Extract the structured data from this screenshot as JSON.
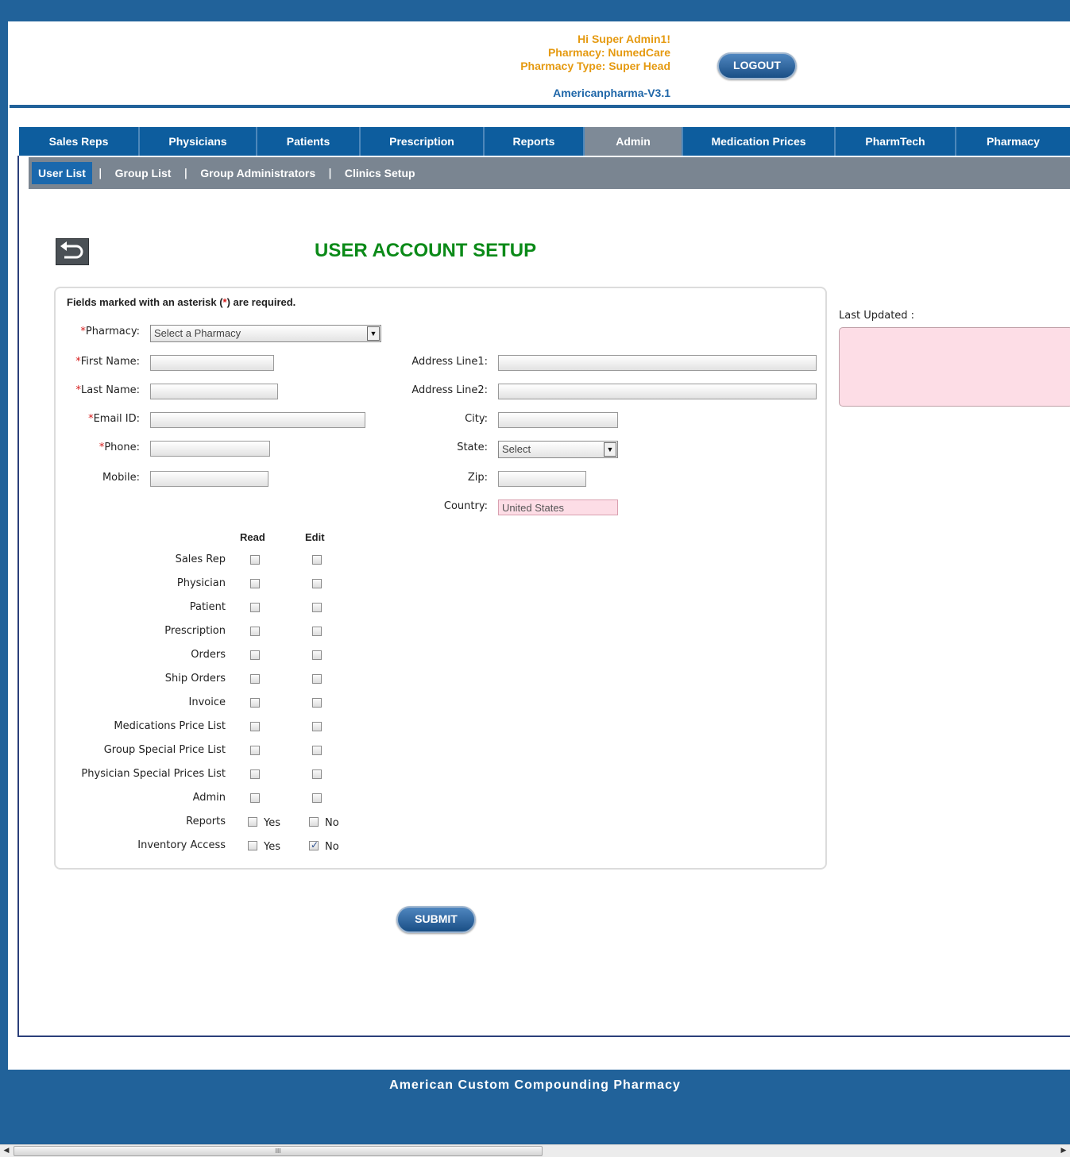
{
  "header": {
    "greeting": "Hi Super Admin1!",
    "pharmacy": "Pharmacy: NumedCare",
    "pharmacy_type": "Pharmacy Type: Super Head",
    "version": "Americanpharma-V3.1",
    "logout_label": "LOGOUT"
  },
  "nav": {
    "tabs": [
      {
        "label": "Sales Reps"
      },
      {
        "label": "Physicians"
      },
      {
        "label": "Patients"
      },
      {
        "label": "Prescription"
      },
      {
        "label": "Reports"
      },
      {
        "label": "Admin",
        "active": true
      },
      {
        "label": "Medication Prices"
      },
      {
        "label": "PharmTech"
      },
      {
        "label": "Pharmacy"
      }
    ]
  },
  "subnav": {
    "items": [
      {
        "label": "User List",
        "active": true
      },
      {
        "label": "Group List"
      },
      {
        "label": "Group Administrators"
      },
      {
        "label": "Clinics Setup"
      }
    ],
    "separator": "|"
  },
  "page": {
    "title": "USER ACCOUNT SETUP"
  },
  "form": {
    "required_note_before": "Fields marked with an asterisk (",
    "required_star": "*",
    "required_note_after": ") are required.",
    "star": "*",
    "pharmacy": {
      "label": "Pharmacy:",
      "value": "Select a Pharmacy"
    },
    "first_name": {
      "label": "First Name:",
      "value": ""
    },
    "last_name": {
      "label": "Last Name:",
      "value": ""
    },
    "email": {
      "label": "Email ID:",
      "value": ""
    },
    "phone": {
      "label": "Phone:",
      "value": ""
    },
    "mobile": {
      "label": "Mobile:",
      "value": ""
    },
    "address1": {
      "label": "Address Line1:",
      "value": ""
    },
    "address2": {
      "label": "Address Line2:",
      "value": ""
    },
    "city": {
      "label": "City:",
      "value": ""
    },
    "state": {
      "label": "State:",
      "value": "Select"
    },
    "zip": {
      "label": "Zip:",
      "value": ""
    },
    "country": {
      "label": "Country:",
      "value": "United States"
    }
  },
  "permissions": {
    "read_header": "Read",
    "edit_header": "Edit",
    "yes_label": "Yes",
    "no_label": "No",
    "rows": [
      {
        "label": "Sales Rep",
        "read": false,
        "edit": false
      },
      {
        "label": "Physician",
        "read": false,
        "edit": false
      },
      {
        "label": "Patient",
        "read": false,
        "edit": false
      },
      {
        "label": "Prescription",
        "read": false,
        "edit": false
      },
      {
        "label": "Orders",
        "read": false,
        "edit": false
      },
      {
        "label": "Ship Orders",
        "read": false,
        "edit": false
      },
      {
        "label": "Invoice",
        "read": false,
        "edit": false
      },
      {
        "label": "Medications Price List",
        "read": false,
        "edit": false
      },
      {
        "label": "Group Special Price List",
        "read": false,
        "edit": false
      },
      {
        "label": "Physician Special Prices List",
        "read": false,
        "edit": false
      },
      {
        "label": "Admin",
        "read": false,
        "edit": false
      }
    ],
    "yes_no_rows": [
      {
        "label": "Reports",
        "yes": false,
        "no": false
      },
      {
        "label": "Inventory Access",
        "yes": false,
        "no": true
      }
    ]
  },
  "sidebar": {
    "last_updated_label": "Last Updated :"
  },
  "submit_label": "SUBMIT",
  "footer": {
    "text": "American Custom Compounding Pharmacy"
  },
  "scrollbar": {
    "grip": "III"
  },
  "icons": {
    "back": "back-arrow-icon",
    "dropdown": "triangle-down-icon",
    "checkbox_check": "check-icon"
  },
  "colors": {
    "brand_blue": "#21629a",
    "nav_blue": "#0d5d9e",
    "active_gray": "#7e8a97",
    "title_green": "#0b8a18",
    "user_info_orange": "#e59a11",
    "required_red": "#d61a1a",
    "pink_field": "#fddde6"
  }
}
